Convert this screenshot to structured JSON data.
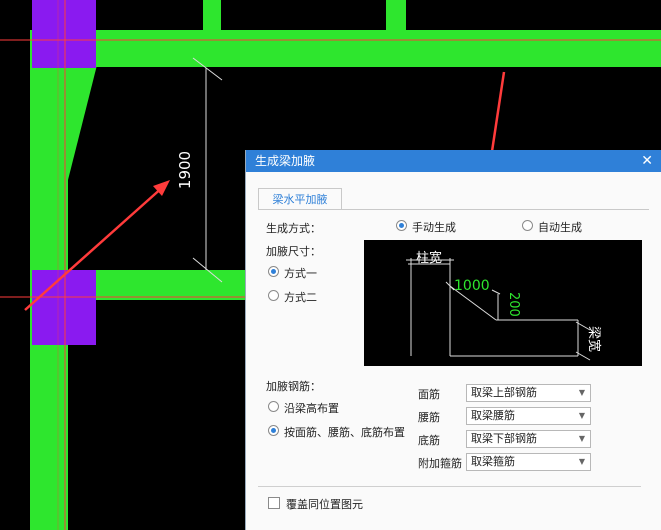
{
  "canvas": {
    "dimension_label": "1900",
    "colors": {
      "beam": "#2ee62e",
      "column": "#8a1af0",
      "axis": "#ff3b3b",
      "background": "#000000"
    }
  },
  "dialog": {
    "title": "生成梁加腋",
    "close_icon": "close-icon",
    "tab_label": "梁水平加腋",
    "generation_mode_label": "生成方式：",
    "manual_option": "手动生成",
    "auto_option": "自动生成",
    "selected_mode": "手动生成",
    "size_label": "加腋尺寸：",
    "method1_option": "方式一",
    "method2_option": "方式二",
    "selected_method": "方式一",
    "preview": {
      "column_width_label": "柱宽",
      "horizontal_value": "1000",
      "vertical_value": "200",
      "beam_width_label": "梁宽"
    },
    "rebar_label": "加腋钢筋：",
    "by_beam_height_option": "沿梁高布置",
    "by_face_option": "按面筋、腰筋、底筋布置",
    "selected_rebar_mode": "按面筋、腰筋、底筋布置",
    "face_bar_label": "面筋",
    "face_bar_value": "取梁上部钢筋",
    "waist_bar_label": "腰筋",
    "waist_bar_value": "取梁腰筋",
    "bottom_bar_label": "底筋",
    "bottom_bar_value": "取梁下部钢筋",
    "extra_bar_label": "附加箍筋",
    "extra_bar_value": "取梁箍筋",
    "overwrite_checkbox_label": "覆盖同位置图元",
    "overwrite_checked": false
  }
}
